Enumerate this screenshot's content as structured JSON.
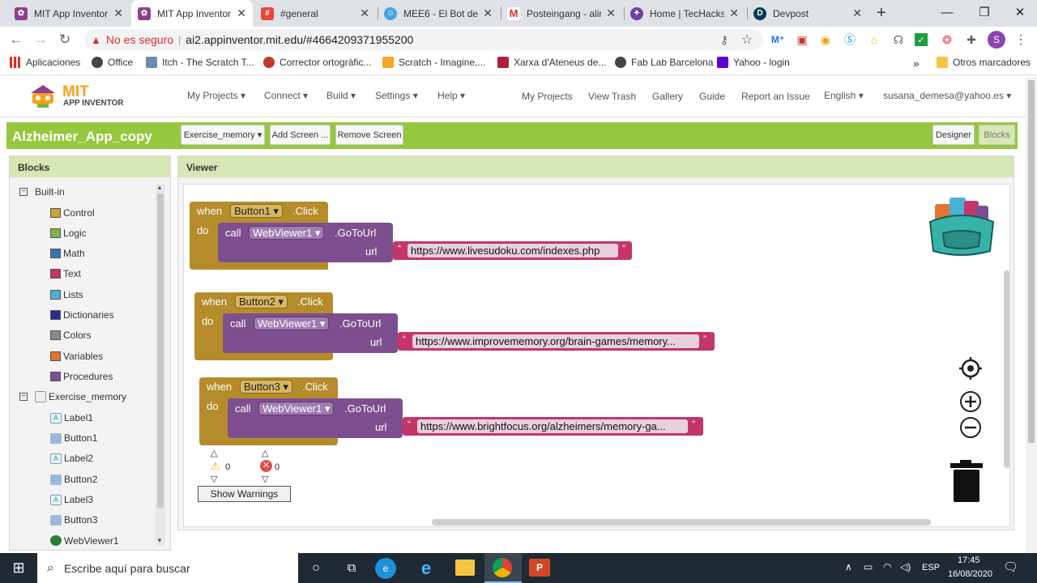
{
  "browser": {
    "tabs": [
      {
        "title": "MIT App Inventor |",
        "active": false
      },
      {
        "title": "MIT App Inventor",
        "active": true
      },
      {
        "title": "#general",
        "active": false
      },
      {
        "title": "MEE6 - El Bot de D",
        "active": false
      },
      {
        "title": "Posteingang - alin",
        "active": false
      },
      {
        "title": "Home | TecHacks",
        "active": false
      },
      {
        "title": "Devpost",
        "active": false
      }
    ],
    "security_label": "No es seguro",
    "url": "ai2.appinventor.mit.edu/#4664209371955200",
    "profile_initial": "S",
    "bookmarks": [
      "Aplicaciones",
      "Office",
      "Itch - The Scratch T...",
      "Corrector ortogràfic...",
      "Scratch - Imagine,...",
      "Xarxa d'Ateneus de...",
      "Fab Lab Barcelona",
      "Yahoo - login"
    ],
    "more_bookmarks": "»",
    "other_bookmarks": "Otros marcadores"
  },
  "app": {
    "logo_line1": "MIT",
    "logo_line2": "APP INVENTOR",
    "menus": [
      "My Projects ▾",
      "Connect ▾",
      "Build ▾",
      "Settings ▾",
      "Help ▾"
    ],
    "links": [
      "My Projects",
      "View Trash",
      "Gallery",
      "Guide",
      "Report an Issue",
      "English ▾",
      "susana_demesa@yahoo.es ▾"
    ],
    "project_name": "Alzheimer_App_copy",
    "screen_select": "Exercise_memory ▾",
    "add_screen": "Add Screen ...",
    "remove_screen": "Remove Screen",
    "designer": "Designer",
    "blocks_btn": "Blocks"
  },
  "blocks_panel": {
    "title": "Blocks",
    "builtin": "Built-in",
    "builtin_items": [
      {
        "label": "Control",
        "color": "#c9a33a"
      },
      {
        "label": "Logic",
        "color": "#7fb04c"
      },
      {
        "label": "Math",
        "color": "#3b6fb6"
      },
      {
        "label": "Text",
        "color": "#c4356a"
      },
      {
        "label": "Lists",
        "color": "#4ab0d6"
      },
      {
        "label": "Dictionaries",
        "color": "#2b2b8f"
      },
      {
        "label": "Colors",
        "color": "#8a8a8a"
      },
      {
        "label": "Variables",
        "color": "#e0752f"
      },
      {
        "label": "Procedures",
        "color": "#7e4f8f"
      }
    ],
    "screen": "Exercise_memory",
    "components": [
      "Label1",
      "Button1",
      "Label2",
      "Button2",
      "Label3",
      "Button3",
      "WebViewer1"
    ]
  },
  "viewer": {
    "title": "Viewer",
    "blocks": [
      {
        "when": "when",
        "component": "Button1 ▾",
        "event": ".Click",
        "do": "do",
        "call": "call",
        "target": "WebViewer1 ▾",
        "method": ".GoToUrl",
        "param": "url",
        "value": "https://www.livesudoku.com/indexes.php"
      },
      {
        "when": "when",
        "component": "Button2 ▾",
        "event": ".Click",
        "do": "do",
        "call": "call",
        "target": "WebViewer1 ▾",
        "method": ".GoToUrl",
        "param": "url",
        "value": "https://www.improvememory.org/brain-games/memory..."
      },
      {
        "when": "when",
        "component": "Button3 ▾",
        "event": ".Click",
        "do": "do",
        "call": "call",
        "target": "WebViewer1 ▾",
        "method": ".GoToUrl",
        "param": "url",
        "value": "https://www.brightfocus.org/alzheimers/memory-ga..."
      }
    ],
    "warnings_count": "0",
    "errors_count": "0",
    "show_warnings": "Show Warnings"
  },
  "taskbar": {
    "search_placeholder": "Escribe aquí para buscar",
    "lang": "ESP",
    "time": "17:45",
    "date": "16/08/2020"
  }
}
